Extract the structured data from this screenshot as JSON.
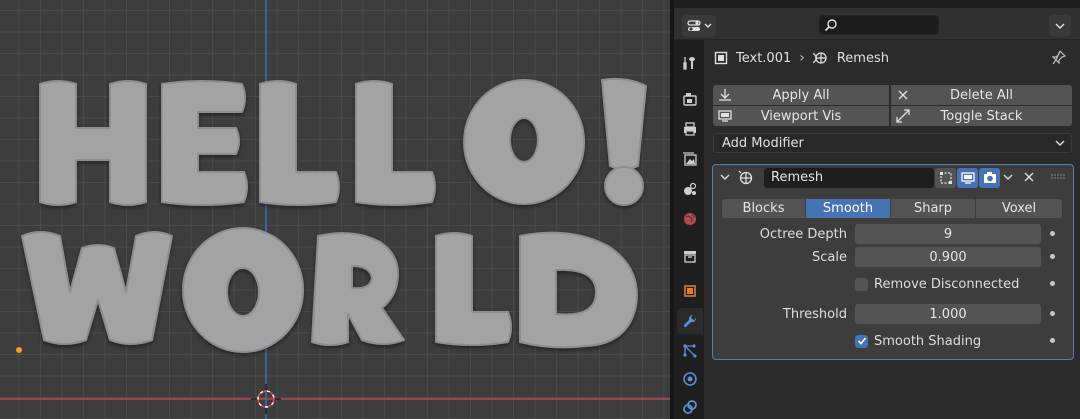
{
  "viewport": {
    "text_object": [
      "HELLO!",
      "WORLD"
    ],
    "colors": {
      "background": "#3d3d3d",
      "grid": "#4a4a4a",
      "y_axis": "#3f6fbf",
      "x_axis": "#b84a4a",
      "mesh": "#a3a3a3",
      "origin": "#f2a023"
    }
  },
  "header": {
    "editor_type_icon": "properties-editor-icon",
    "search_icon": "search-icon",
    "options_icon": "chevron-down-icon"
  },
  "tabs": [
    {
      "name": "tool-tab",
      "icon": "tool-icon"
    },
    {
      "name": "render-tab",
      "icon": "render-camera-icon"
    },
    {
      "name": "output-tab",
      "icon": "printer-icon"
    },
    {
      "name": "view-layer-tab",
      "icon": "image-icon"
    },
    {
      "name": "scene-tab",
      "icon": "scene-icon"
    },
    {
      "name": "world-tab",
      "icon": "world-icon"
    },
    {
      "name": "collection-tab",
      "icon": "collection-box-icon"
    },
    {
      "name": "object-tab",
      "icon": "object-icon"
    },
    {
      "name": "modifiers-tab",
      "icon": "wrench-icon",
      "active": true
    },
    {
      "name": "particles-tab",
      "icon": "particles-icon"
    },
    {
      "name": "physics-tab",
      "icon": "physics-icon"
    },
    {
      "name": "constraints-tab",
      "icon": "constraint-icon"
    }
  ],
  "breadcrumb": {
    "object": "Text.001",
    "modifier": "Remesh"
  },
  "buttons": {
    "apply_all": "Apply All",
    "delete_all": "Delete All",
    "viewport_vis": "Viewport Vis",
    "toggle_stack": "Toggle Stack"
  },
  "add_modifier": "Add Modifier",
  "modifier": {
    "name": "Remesh",
    "modes": [
      "Blocks",
      "Smooth",
      "Sharp",
      "Voxel"
    ],
    "active_mode": "Smooth",
    "octree_depth_label": "Octree Depth",
    "octree_depth": "9",
    "scale_label": "Scale",
    "scale": "0.900",
    "remove_disconnected_label": "Remove Disconnected",
    "remove_disconnected": false,
    "threshold_label": "Threshold",
    "threshold": "1.000",
    "smooth_shading_label": "Smooth Shading",
    "smooth_shading": true
  },
  "accent_color": "#4772b3"
}
